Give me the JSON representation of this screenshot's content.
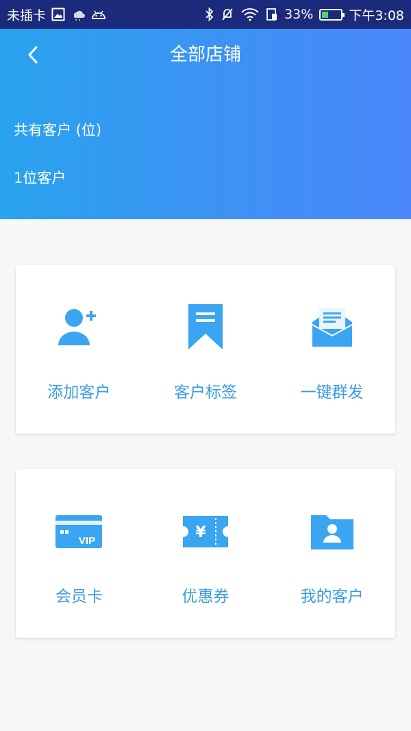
{
  "status_bar": {
    "carrier": "未插卡",
    "battery_percent": "33%",
    "battery_level": 0.33,
    "time": "下午3:08"
  },
  "header": {
    "title": "全部店铺",
    "customer_count_label": "共有客户 (位)",
    "customer_count_value": "1位客户"
  },
  "grid_1": [
    {
      "label": "添加客户",
      "icon": "add-user-icon"
    },
    {
      "label": "客户标签",
      "icon": "bookmark-icon"
    },
    {
      "label": "一键群发",
      "icon": "mail-icon"
    }
  ],
  "grid_2": [
    {
      "label": "会员卡",
      "icon": "vip-card-icon",
      "icon_text": "VIP"
    },
    {
      "label": "优惠券",
      "icon": "coupon-icon",
      "icon_text": "¥"
    },
    {
      "label": "我的客户",
      "icon": "customer-folder-icon"
    }
  ],
  "colors": {
    "accent": "#3a9be6",
    "icon": "#3aa5f0",
    "header_start": "#29a3ee",
    "header_end": "#4b88fb",
    "status_bar": "#1b2a7a"
  }
}
